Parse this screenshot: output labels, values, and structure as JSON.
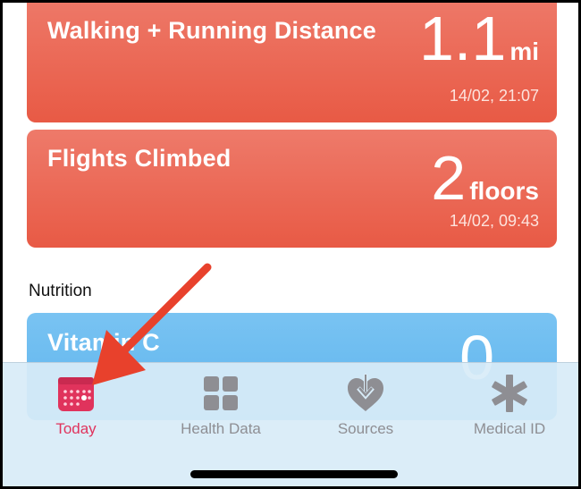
{
  "cards": [
    {
      "title": "Walking + Running Distance",
      "value": "1.1",
      "unit": "mi",
      "timestamp": "14/02, 21:07",
      "color": "#e85a45"
    },
    {
      "title": "Flights Climbed",
      "value": "2",
      "unit": "floors",
      "timestamp": "14/02, 09:43",
      "color": "#e85a45"
    }
  ],
  "section": {
    "title": "Nutrition"
  },
  "nutrition_card": {
    "title": "Vitamin C",
    "value": "0",
    "color": "#5db4ee"
  },
  "tabbar": {
    "tabs": [
      {
        "label": "Today",
        "icon": "calendar-icon",
        "active": true
      },
      {
        "label": "Health Data",
        "icon": "grid-icon",
        "active": false
      },
      {
        "label": "Sources",
        "icon": "heart-download-icon",
        "active": false
      },
      {
        "label": "Medical ID",
        "icon": "asterisk-icon",
        "active": false
      }
    ]
  },
  "colors": {
    "active_tab": "#e0335c",
    "inactive_tab": "#8e8e93",
    "annotation_arrow": "#e8412c"
  }
}
